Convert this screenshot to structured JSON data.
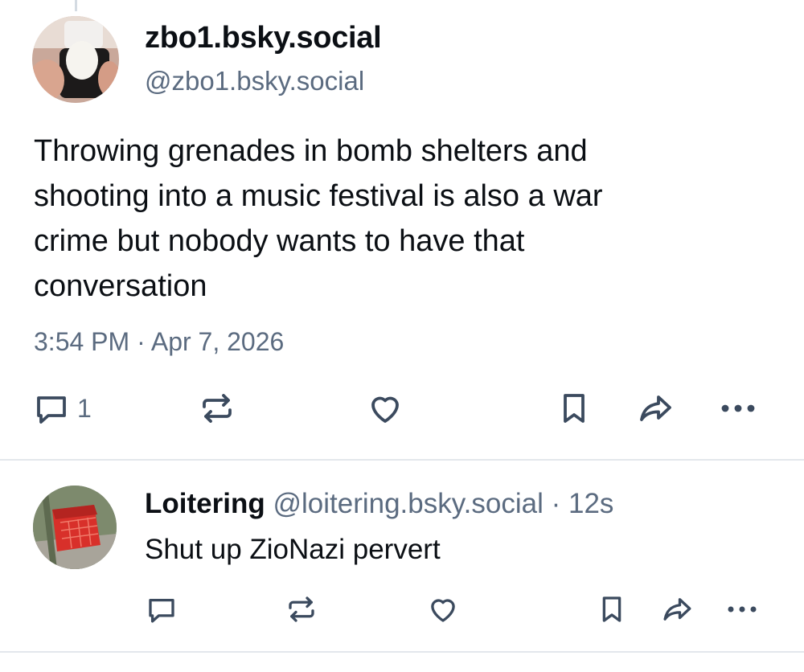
{
  "main_post": {
    "display_name": "zbo1.bsky.social",
    "handle": "@zbo1.bsky.social",
    "text_lines": [
      "Throwing grenades in bomb shelters and",
      "shooting into a music festival is also a war",
      "crime but nobody wants to have that",
      "conversation"
    ],
    "timestamp": "3:54 PM · Apr 7, 2026",
    "reply_count": "1",
    "icons": [
      "reply-icon",
      "repost-icon",
      "like-icon",
      "bookmark-icon",
      "share-icon",
      "more-icon"
    ]
  },
  "reply_post": {
    "display_name": "Loitering",
    "handle": "@loitering.bsky.social",
    "separator": "·",
    "age": "12s",
    "text": "Shut up ZioNazi pervert",
    "icons": [
      "reply-icon",
      "repost-icon",
      "like-icon",
      "bookmark-icon",
      "share-icon",
      "more-icon"
    ]
  },
  "colors": {
    "text": "#0b0f14",
    "muted": "#5b6b80",
    "icon": "#3b4a5e",
    "divider": "#e3e7ec"
  }
}
